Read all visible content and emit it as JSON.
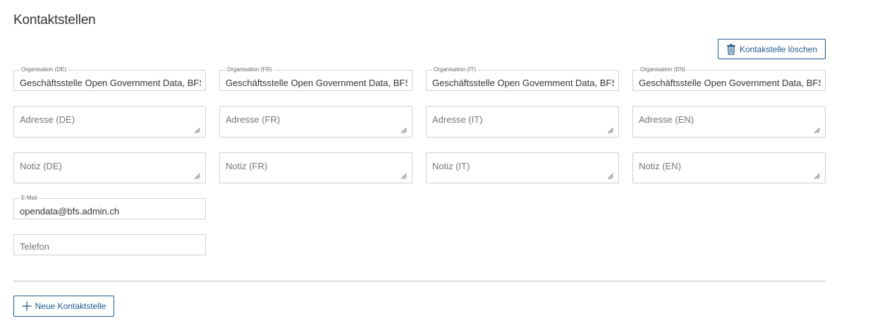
{
  "page": {
    "title": "Kontaktstellen"
  },
  "buttons": {
    "delete_label": "Kontakstelle löschen",
    "new_label": "Neue Kontaktstelle"
  },
  "organisation": {
    "de": {
      "label": "Organisation (DE)",
      "value": "Geschäftsstelle Open Government Data, BFS"
    },
    "fr": {
      "label": "Organisation (FR)",
      "value": "Geschäftsstelle Open Government Data, BFS"
    },
    "it": {
      "label": "Organisation (IT)",
      "value": "Geschäftsstelle Open Government Data, BFS"
    },
    "en": {
      "label": "Organisation (EN)",
      "value": "Geschäftsstelle Open Government Data, BFS"
    }
  },
  "adresse": {
    "de": {
      "placeholder": "Adresse (DE)"
    },
    "fr": {
      "placeholder": "Adresse (FR)"
    },
    "it": {
      "placeholder": "Adresse (IT)"
    },
    "en": {
      "placeholder": "Adresse (EN)"
    }
  },
  "notiz": {
    "de": {
      "placeholder": "Notiz (DE)"
    },
    "fr": {
      "placeholder": "Notiz (FR)"
    },
    "it": {
      "placeholder": "Notiz (IT)"
    },
    "en": {
      "placeholder": "Notiz (EN)"
    }
  },
  "email": {
    "label": "E-Mail",
    "value": "opendata@bfs.admin.ch"
  },
  "telefon": {
    "placeholder": "Telefon"
  },
  "colors": {
    "accent": "#1f5a8c",
    "border": "#d0d0d0",
    "divider": "#b8b8b8"
  },
  "icons": {
    "delete": "trash-icon",
    "new": "plus-icon"
  }
}
